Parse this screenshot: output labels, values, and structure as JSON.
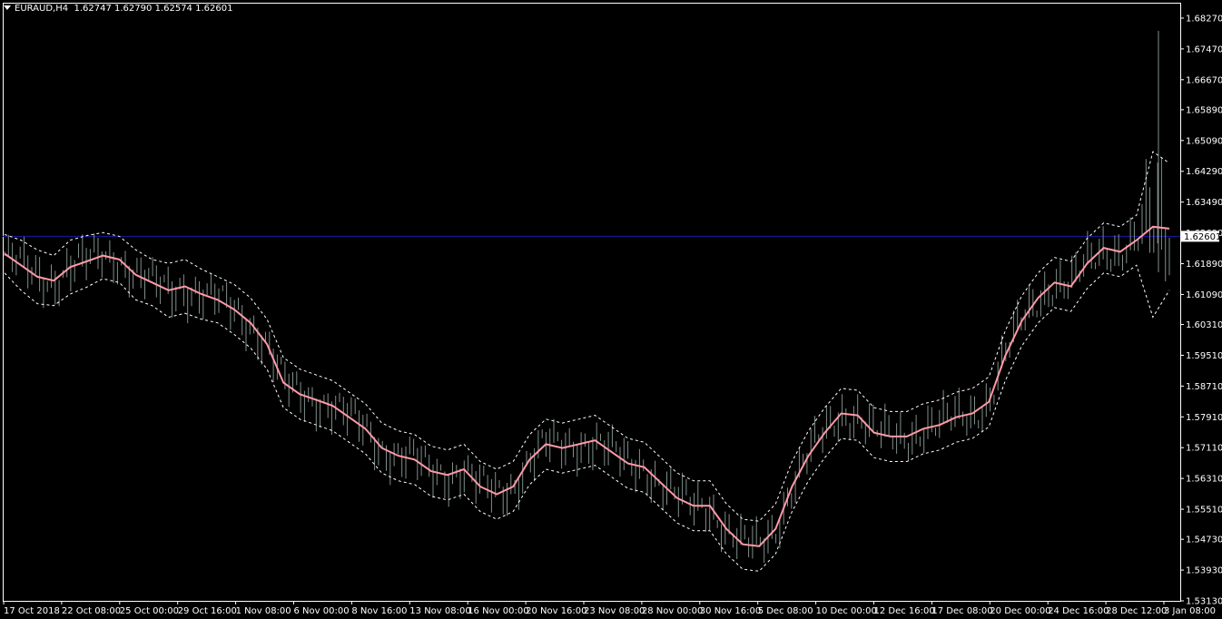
{
  "header": {
    "symbol": "EURAUD,H4",
    "open": "1.62747",
    "high": "1.62790",
    "low": "1.62574",
    "close": "1.62601"
  },
  "colors": {
    "background": "#000000",
    "axis": "#ffffff",
    "bars": "#7f8f8a",
    "ma": "#ff9aa8",
    "bands": "#ffffff",
    "current_price_line": "#1a1aa6",
    "current_price_label_bg": "#ffffff"
  },
  "chart_data": {
    "type": "line",
    "ylim": [
      1.5313,
      1.6867
    ],
    "y_ticks": [
      "1.68270",
      "1.67470",
      "1.66670",
      "1.65890",
      "1.65090",
      "1.64290",
      "1.63490",
      "1.62690",
      "1.61890",
      "1.61090",
      "1.60310",
      "1.59510",
      "1.58710",
      "1.57910",
      "1.57110",
      "1.56310",
      "1.55510",
      "1.54730",
      "1.53930",
      "1.53130"
    ],
    "x_ticks": [
      "17 Oct 2018",
      "22 Oct 08:00",
      "25 Oct 00:00",
      "29 Oct 16:00",
      "1 Nov 08:00",
      "6 Nov 00:00",
      "8 Nov 16:00",
      "13 Nov 08:00",
      "16 Nov 00:00",
      "20 Nov 16:00",
      "23 Nov 08:00",
      "28 Nov 00:00",
      "30 Nov 16:00",
      "5 Dec 08:00",
      "10 Dec 00:00",
      "12 Dec 16:00",
      "17 Dec 08:00",
      "20 Dec 00:00",
      "24 Dec 16:00",
      "28 Dec 12:00",
      "3 Jan 08:00"
    ],
    "current_price": 1.62601,
    "current_price_label": "1.62601",
    "series": [
      {
        "kind": "moving-average",
        "values": [
          1.6215,
          1.6185,
          1.6155,
          1.6145,
          1.618,
          1.6195,
          1.621,
          1.62,
          1.616,
          1.614,
          1.612,
          1.613,
          1.611,
          1.6095,
          1.607,
          1.6035,
          1.598,
          1.588,
          1.585,
          1.5835,
          1.582,
          1.579,
          1.576,
          1.571,
          1.569,
          1.568,
          1.565,
          1.564,
          1.5655,
          1.561,
          1.559,
          1.561,
          1.568,
          1.572,
          1.571,
          1.572,
          1.573,
          1.57,
          1.567,
          1.566,
          1.562,
          1.558,
          1.556,
          1.556,
          1.55,
          1.546,
          1.5455,
          1.55,
          1.561,
          1.569,
          1.575,
          1.58,
          1.5795,
          1.575,
          1.574,
          1.574,
          1.576,
          1.577,
          1.579,
          1.58,
          1.583,
          1.595,
          1.604,
          1.61,
          1.614,
          1.613,
          1.619,
          1.623,
          1.622,
          1.625,
          1.6285,
          1.628
        ]
      },
      {
        "kind": "upper-band",
        "values": [
          1.6265,
          1.625,
          1.6225,
          1.621,
          1.625,
          1.6262,
          1.627,
          1.626,
          1.6225,
          1.62,
          1.619,
          1.62,
          1.6175,
          1.6155,
          1.6135,
          1.61,
          1.6045,
          1.5945,
          1.5915,
          1.59,
          1.5885,
          1.5855,
          1.5825,
          1.5775,
          1.5755,
          1.5745,
          1.5715,
          1.5705,
          1.572,
          1.5675,
          1.5655,
          1.5675,
          1.5745,
          1.5785,
          1.5775,
          1.5785,
          1.5795,
          1.5765,
          1.5735,
          1.5725,
          1.5685,
          1.5645,
          1.5625,
          1.5625,
          1.5565,
          1.5525,
          1.552,
          1.5565,
          1.5675,
          1.5755,
          1.5815,
          1.5865,
          1.586,
          1.5815,
          1.5805,
          1.5805,
          1.5825,
          1.5835,
          1.5855,
          1.5865,
          1.5895,
          1.6015,
          1.6105,
          1.6165,
          1.6205,
          1.6195,
          1.6255,
          1.6295,
          1.6285,
          1.6315,
          1.648,
          1.645
        ]
      },
      {
        "kind": "lower-band",
        "values": [
          1.6165,
          1.612,
          1.6085,
          1.608,
          1.611,
          1.6128,
          1.615,
          1.614,
          1.6095,
          1.608,
          1.605,
          1.606,
          1.6045,
          1.6035,
          1.6005,
          1.597,
          1.5915,
          1.5815,
          1.5785,
          1.577,
          1.5755,
          1.5725,
          1.5695,
          1.5645,
          1.5625,
          1.5615,
          1.5585,
          1.5575,
          1.559,
          1.5545,
          1.5525,
          1.5545,
          1.5615,
          1.5655,
          1.5645,
          1.5655,
          1.5665,
          1.5635,
          1.5605,
          1.5595,
          1.5555,
          1.5515,
          1.5495,
          1.5495,
          1.5435,
          1.5395,
          1.539,
          1.5435,
          1.5545,
          1.5625,
          1.5685,
          1.5735,
          1.573,
          1.5685,
          1.5675,
          1.5675,
          1.5695,
          1.5705,
          1.5725,
          1.5735,
          1.5765,
          1.5885,
          1.5975,
          1.6035,
          1.6075,
          1.6065,
          1.6125,
          1.6165,
          1.6155,
          1.6185,
          1.605,
          1.612
        ]
      }
    ]
  }
}
